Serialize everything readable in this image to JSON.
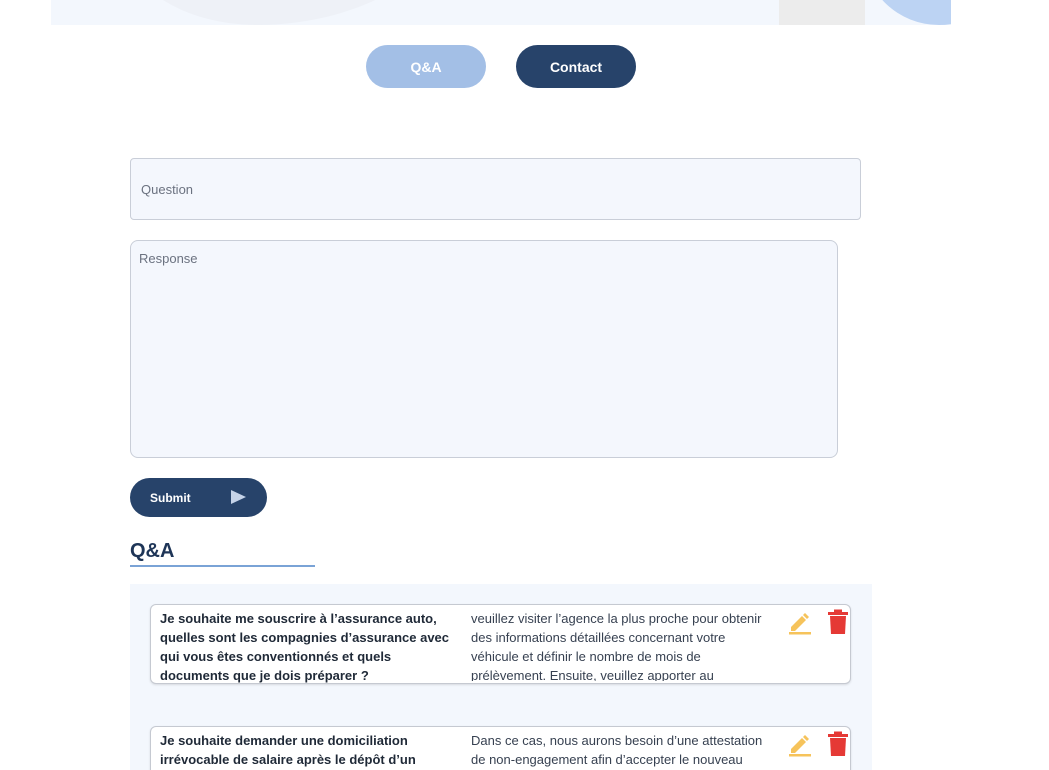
{
  "nav": {
    "qa_label": "Q&A",
    "contact_label": "Contact"
  },
  "form": {
    "question_placeholder": "Question",
    "response_placeholder": "Response",
    "submit_label": "Submit"
  },
  "qa_section": {
    "heading": "Q&A",
    "items": [
      {
        "question": "Je souhaite me souscrire à l’assurance auto, quelles sont les compagnies d’assurance avec qui vous êtes conventionnés et quels documents que je dois préparer ?",
        "answer": "veuillez visiter l’agence la plus proche pour obtenir des informations détaillées concernant votre véhicule et définir le nombre de mois de prélèvement. Ensuite, veuillez apporter au"
      },
      {
        "question": "Je souhaite demander une domiciliation irrévocable de salaire après le dépôt d’un",
        "answer": "Dans ce cas, nous aurons besoin d’une attestation de non-engagement afin d’accepter le nouveau RIB. Pour la domiciliation, elle sera"
      }
    ]
  },
  "icons": {
    "edit": "edit-pencil-icon",
    "delete": "trash-icon"
  },
  "colors": {
    "primary": "#27436a",
    "primary_light": "#a3bfe6",
    "edit": "#f6c35b",
    "delete": "#e53935"
  }
}
